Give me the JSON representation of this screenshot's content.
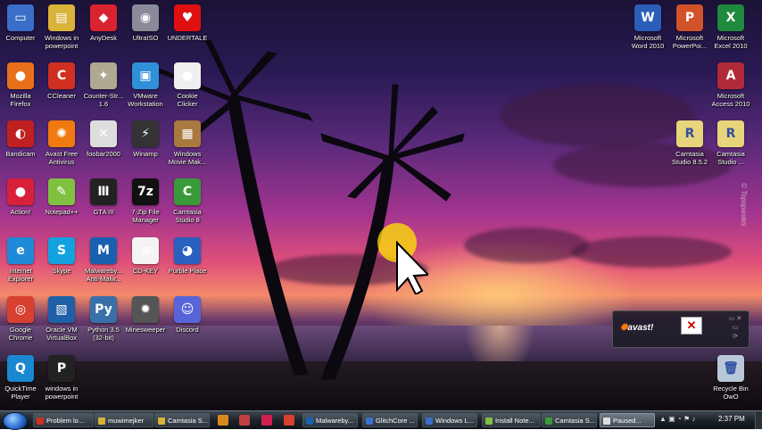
{
  "desktop": {
    "left_icons": [
      {
        "label": "Computer",
        "name": "computer-icon",
        "glyph": "▭",
        "color": "#3a6ec8"
      },
      {
        "label": "Windows in\npowerpoint",
        "name": "folder-icon",
        "glyph": "▤",
        "color": "#d9b23a"
      },
      {
        "label": "AnyDesk",
        "name": "anydesk-icon",
        "glyph": "◆",
        "color": "#d9232e"
      },
      {
        "label": "UltraISO",
        "name": "disc-icon",
        "glyph": "◉",
        "color": "#8a8a9a"
      },
      {
        "label": "UNDERTALE",
        "name": "heart-icon",
        "glyph": "♥",
        "color": "#e01010"
      },
      {
        "label": "Mozilla\nFirefox",
        "name": "firefox-icon",
        "glyph": "●",
        "color": "#e8701a"
      },
      {
        "label": "CCleaner",
        "name": "ccleaner-icon",
        "glyph": "C",
        "color": "#d03020"
      },
      {
        "label": "Counter-Str...\n1.6",
        "name": "counter-strike-icon",
        "glyph": "✦",
        "color": "#b0a890"
      },
      {
        "label": "VMware\nWorkstation",
        "name": "vmware-icon",
        "glyph": "▣",
        "color": "#2f8fd8"
      },
      {
        "label": "Cookie\nClicker",
        "name": "cookie-icon",
        "glyph": "●",
        "color": "#f0f0f0"
      },
      {
        "label": "Bandicam",
        "name": "bandicam-icon",
        "glyph": "◐",
        "color": "#c02020"
      },
      {
        "label": "Avast Free\nAntivirus",
        "name": "avast-icon",
        "glyph": "✺",
        "color": "#f07a10"
      },
      {
        "label": "foobar2000",
        "name": "foobar-icon",
        "glyph": "✕",
        "color": "#dddddd"
      },
      {
        "label": "Winamp",
        "name": "winamp-icon",
        "glyph": "⚡",
        "color": "#333333"
      },
      {
        "label": "Windows\nMovie Mak...",
        "name": "movie-maker-icon",
        "glyph": "▦",
        "color": "#a87a40"
      },
      {
        "label": "Action!",
        "name": "action-icon",
        "glyph": "●",
        "color": "#d8203a"
      },
      {
        "label": "Notepad++",
        "name": "notepadpp-icon",
        "glyph": "✎",
        "color": "#80c040"
      },
      {
        "label": "GTA III",
        "name": "gta3-icon",
        "glyph": "Ⅲ",
        "color": "#222222"
      },
      {
        "label": "7-Zip File\nManager",
        "name": "7zip-icon",
        "glyph": "7z",
        "color": "#111111"
      },
      {
        "label": "Camtasia\nStudio 8",
        "name": "camtasia-icon",
        "glyph": "C",
        "color": "#3a9a3a"
      },
      {
        "label": "Internet\nExplorer",
        "name": "ie-icon",
        "glyph": "e",
        "color": "#1e8ad8"
      },
      {
        "label": "Skype",
        "name": "skype-icon",
        "glyph": "S",
        "color": "#13a2e0"
      },
      {
        "label": "Malwareby...\nAnti-Malw...",
        "name": "malwarebytes-icon",
        "glyph": "M",
        "color": "#1a60b0"
      },
      {
        "label": "CD-KEY",
        "name": "text-file-icon",
        "glyph": "≡",
        "color": "#f4f4f4"
      },
      {
        "label": "Purble Place",
        "name": "purble-place-icon",
        "glyph": "◕",
        "color": "#2a60c0"
      },
      {
        "label": "Google\nChrome",
        "name": "chrome-icon",
        "glyph": "◎",
        "color": "#d84030"
      },
      {
        "label": "Oracle VM\nVirtualBox",
        "name": "virtualbox-icon",
        "glyph": "▧",
        "color": "#2060a8"
      },
      {
        "label": "Python 3.5\n(32-bit)",
        "name": "python-icon",
        "glyph": "Py",
        "color": "#3a70a8"
      },
      {
        "label": "Minesweeper",
        "name": "minesweeper-icon",
        "glyph": "✹",
        "color": "#555555"
      },
      {
        "label": "Discord",
        "name": "discord-icon",
        "glyph": "☺",
        "color": "#5865d8"
      },
      {
        "label": "QuickTime\nPlayer",
        "name": "quicktime-icon",
        "glyph": "Q",
        "color": "#1a88d0"
      },
      {
        "label": "windows in\npowerpoint",
        "name": "powerpoint-file-icon",
        "glyph": "P",
        "color": "#222222"
      }
    ],
    "right_icons": [
      {
        "label": "Microsoft\nWord 2010",
        "name": "word-icon",
        "glyph": "W",
        "color": "#2b5eb8"
      },
      {
        "label": "Microsoft\nPowerPoi...",
        "name": "powerpoint-icon",
        "glyph": "P",
        "color": "#d2522a"
      },
      {
        "label": "Microsoft\nExcel 2010",
        "name": "excel-icon",
        "glyph": "X",
        "color": "#1f8a3e"
      },
      {
        "label": "Microsoft\nAccess 2010",
        "name": "access-icon",
        "glyph": "A",
        "color": "#b02a3a"
      },
      {
        "label": "Camtasia\nStudio 8.5.2",
        "name": "camtasia-folder-icon",
        "glyph": "R",
        "color": "#e8d47a"
      },
      {
        "label": "Camtasia\nStudio ...",
        "name": "camtasia-folder-icon-2",
        "glyph": "R",
        "color": "#e8d47a"
      },
      {
        "label": "Recycle Bin\nOwO",
        "name": "recycle-bin-icon",
        "glyph": "🗑",
        "color": "#b8c8d8"
      }
    ],
    "watermark": "© Topspastes"
  },
  "avast_widget": {
    "brand_prefix": "",
    "brand": "avast!",
    "status_glyph": "✕"
  },
  "taskbar": {
    "quick_launch": [
      {
        "name": "taskbar-pin-1-icon",
        "color": "#d88a20"
      },
      {
        "name": "taskbar-pin-2-icon",
        "color": "#c04040"
      },
      {
        "name": "taskbar-pin-3-icon",
        "color": "#d02050"
      },
      {
        "name": "taskbar-pin-4-icon",
        "color": "#d84030"
      }
    ],
    "buttons": [
      {
        "label": "Problem lo...",
        "color": "#d03020"
      },
      {
        "label": "muwimejker",
        "color": "#d9b23a"
      },
      {
        "label": "Camtasia S...",
        "color": "#d9b23a"
      },
      {
        "label": "Malwareby...",
        "color": "#1a60b0"
      },
      {
        "label": "GlitchCore ...",
        "color": "#3a70d0"
      },
      {
        "label": "Windows L...",
        "color": "#3a6ec8"
      },
      {
        "label": "Install Note...",
        "color": "#80c040"
      },
      {
        "label": "Camtasia S...",
        "color": "#3a9a3a"
      },
      {
        "label": "Paused...",
        "color": "#dddddd"
      }
    ],
    "clock": "2:37 PM"
  }
}
